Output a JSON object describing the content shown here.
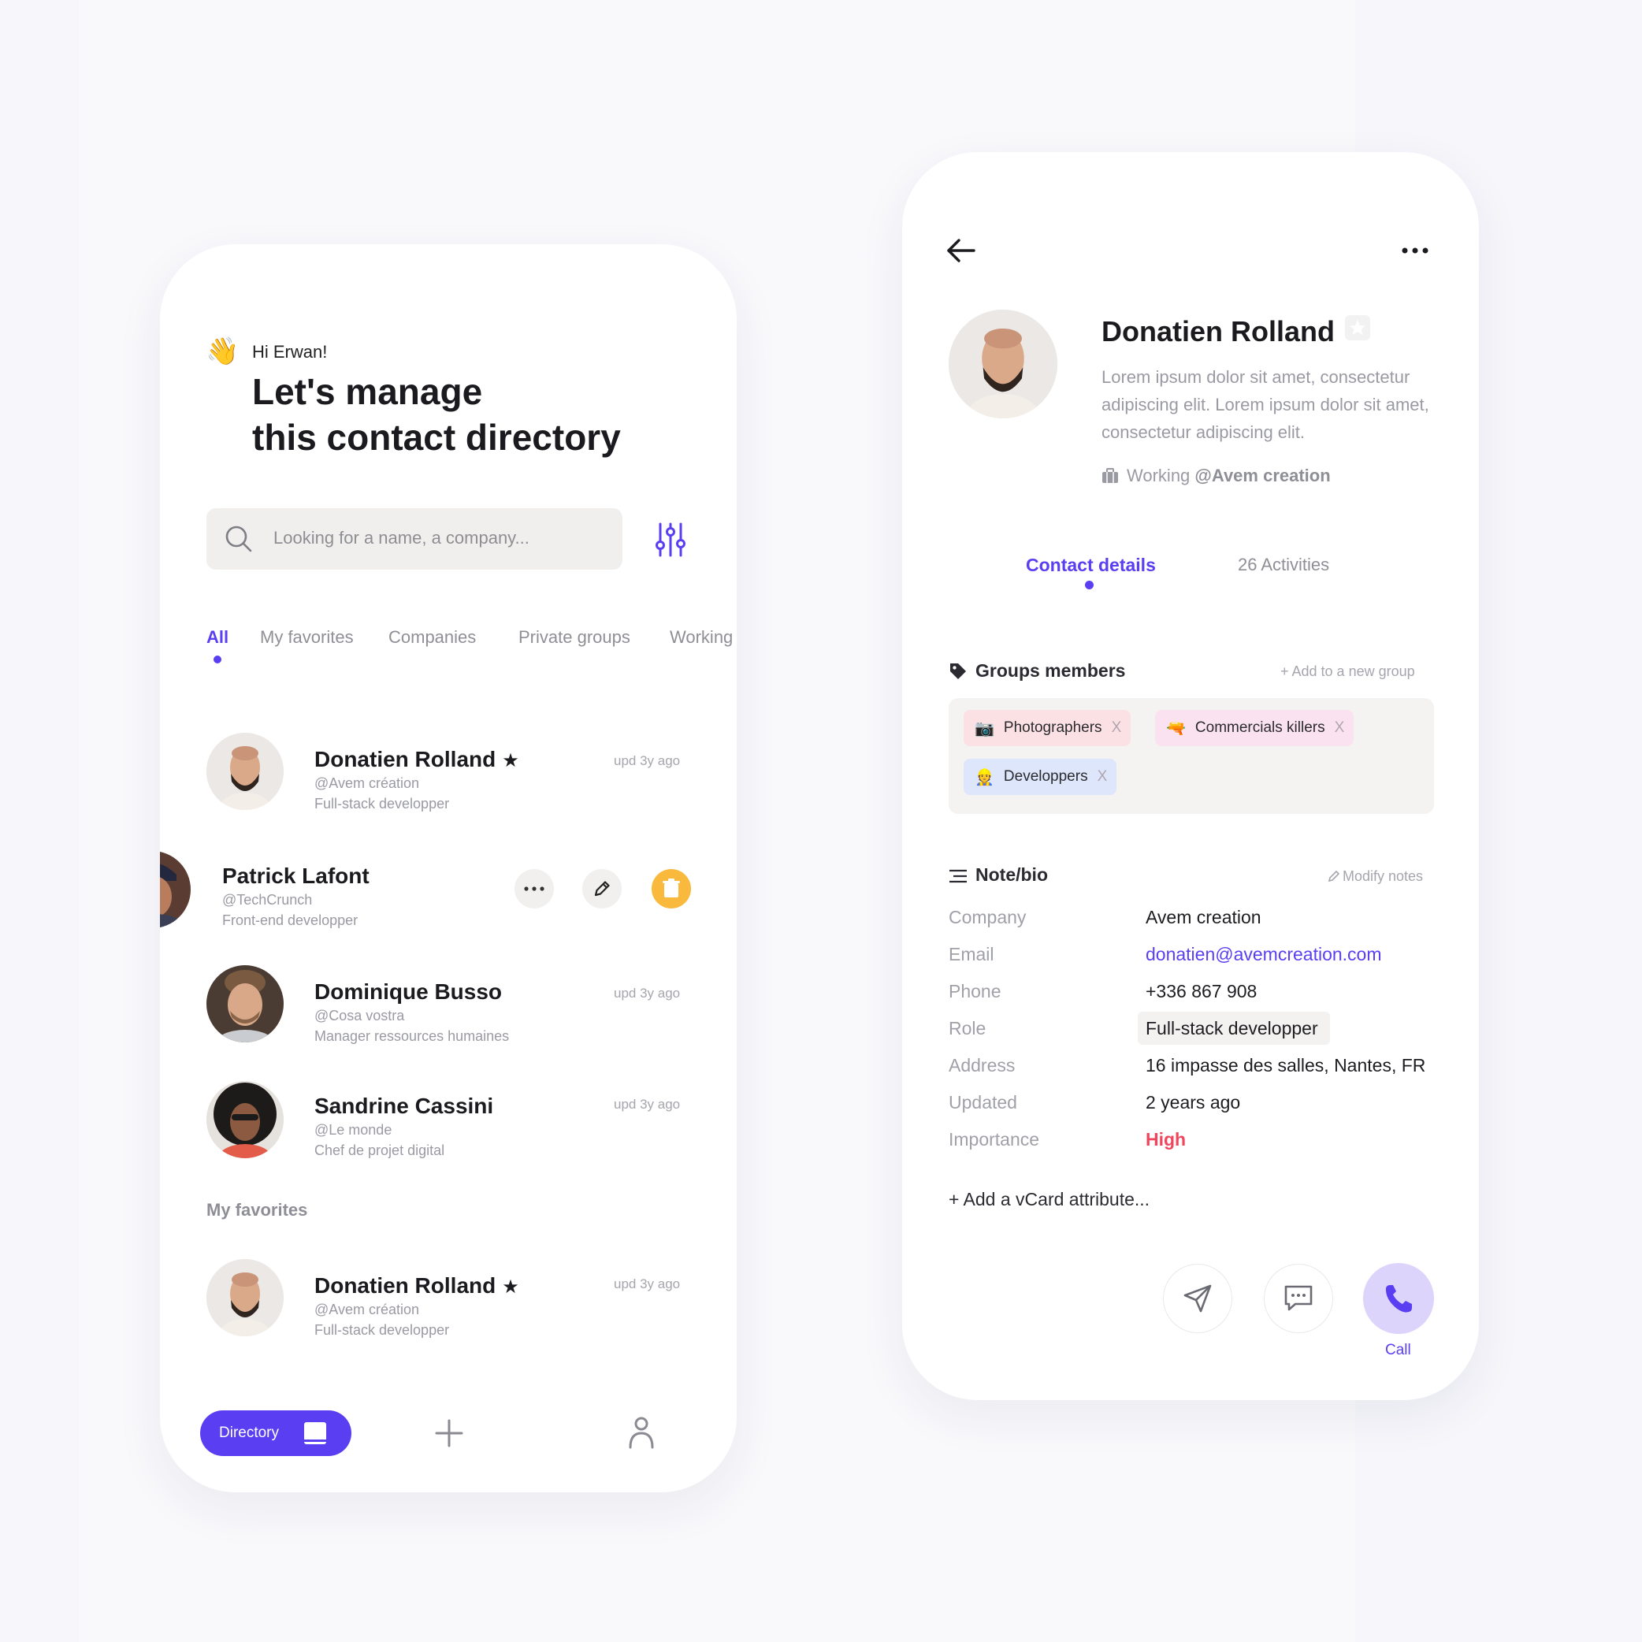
{
  "colors": {
    "accent": "#5a3ff2",
    "danger": "#f0455c",
    "delete": "#f8b93c",
    "call_bg": "#ddd4fb"
  },
  "directory": {
    "greeting": "Hi Erwan!",
    "wave_icon": "👋",
    "headline_line1": "Let's manage",
    "headline_line2": "this contact directory",
    "search_placeholder": "Looking for a name, a company...",
    "tabs": [
      "All",
      "My favorites",
      "Companies",
      "Private groups",
      "Working"
    ],
    "active_tab": "All",
    "contacts": [
      {
        "name": "Donatien Rolland",
        "favorite_icon": "★",
        "handle": "@Avem création",
        "role": "Full-stack developper",
        "updated": "upd 3y ago"
      },
      {
        "name": "Patrick Lafont",
        "handle": "@TechCrunch",
        "role": "Front-end developper"
      },
      {
        "name": "Dominique Busso",
        "handle": "@Cosa vostra",
        "role": "Manager ressources humaines",
        "updated": "upd 3y ago"
      },
      {
        "name": "Sandrine Cassini",
        "handle": "@Le monde",
        "role": "Chef de projet digital",
        "updated": "upd 3y ago"
      }
    ],
    "favorites_section": "My favorites",
    "favorites": [
      {
        "name": "Donatien Rolland",
        "favorite_icon": "★",
        "handle": "@Avem création",
        "role": "Full-stack developper",
        "updated": "upd 3y ago"
      }
    ],
    "nav": {
      "directory": "Directory"
    }
  },
  "profile": {
    "name": "Donatien Rolland",
    "bio": "Lorem ipsum dolor sit amet, consectetur adipiscing elit. Lorem ipsum dolor sit amet, consectetur adipiscing elit.",
    "working_prefix": "Working",
    "working_company": "@Avem creation",
    "tabs": {
      "details": "Contact details",
      "activities": "26 Activities"
    },
    "groups_title": "Groups members",
    "groups_add": "+ Add to a new group",
    "groups": [
      {
        "emoji": "📷",
        "label": "Photographers"
      },
      {
        "emoji": "🔫",
        "label": "Commercials killers"
      },
      {
        "emoji": "👷",
        "label": "Developpers"
      }
    ],
    "chip_remove": "X",
    "note_title": "Note/bio",
    "note_modify": "Modify notes",
    "details": {
      "company_label": "Company",
      "company": "Avem creation",
      "email_label": "Email",
      "email": "donatien@avemcreation.com",
      "phone_label": "Phone",
      "phone": "+336 867 908",
      "role_label": "Role",
      "role": "Full-stack developper",
      "address_label": "Address",
      "address": "16 impasse des salles, Nantes, FR",
      "updated_label": "Updated",
      "updated": "2 years ago",
      "importance_label": "Importance",
      "importance": "High"
    },
    "add_vcard": "+ Add a vCard attribute...",
    "call_label": "Call"
  }
}
